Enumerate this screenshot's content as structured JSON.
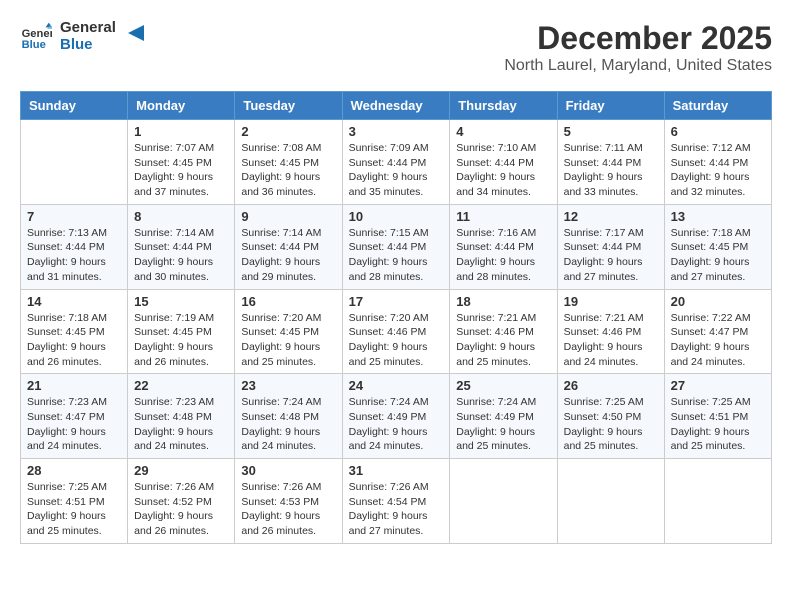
{
  "header": {
    "logo_line1": "General",
    "logo_line2": "Blue",
    "month_title": "December 2025",
    "location": "North Laurel, Maryland, United States"
  },
  "days_of_week": [
    "Sunday",
    "Monday",
    "Tuesday",
    "Wednesday",
    "Thursday",
    "Friday",
    "Saturday"
  ],
  "weeks": [
    [
      {
        "day": "",
        "sunrise": "",
        "sunset": "",
        "daylight": ""
      },
      {
        "day": "1",
        "sunrise": "Sunrise: 7:07 AM",
        "sunset": "Sunset: 4:45 PM",
        "daylight": "Daylight: 9 hours and 37 minutes."
      },
      {
        "day": "2",
        "sunrise": "Sunrise: 7:08 AM",
        "sunset": "Sunset: 4:45 PM",
        "daylight": "Daylight: 9 hours and 36 minutes."
      },
      {
        "day": "3",
        "sunrise": "Sunrise: 7:09 AM",
        "sunset": "Sunset: 4:44 PM",
        "daylight": "Daylight: 9 hours and 35 minutes."
      },
      {
        "day": "4",
        "sunrise": "Sunrise: 7:10 AM",
        "sunset": "Sunset: 4:44 PM",
        "daylight": "Daylight: 9 hours and 34 minutes."
      },
      {
        "day": "5",
        "sunrise": "Sunrise: 7:11 AM",
        "sunset": "Sunset: 4:44 PM",
        "daylight": "Daylight: 9 hours and 33 minutes."
      },
      {
        "day": "6",
        "sunrise": "Sunrise: 7:12 AM",
        "sunset": "Sunset: 4:44 PM",
        "daylight": "Daylight: 9 hours and 32 minutes."
      }
    ],
    [
      {
        "day": "7",
        "sunrise": "Sunrise: 7:13 AM",
        "sunset": "Sunset: 4:44 PM",
        "daylight": "Daylight: 9 hours and 31 minutes."
      },
      {
        "day": "8",
        "sunrise": "Sunrise: 7:14 AM",
        "sunset": "Sunset: 4:44 PM",
        "daylight": "Daylight: 9 hours and 30 minutes."
      },
      {
        "day": "9",
        "sunrise": "Sunrise: 7:14 AM",
        "sunset": "Sunset: 4:44 PM",
        "daylight": "Daylight: 9 hours and 29 minutes."
      },
      {
        "day": "10",
        "sunrise": "Sunrise: 7:15 AM",
        "sunset": "Sunset: 4:44 PM",
        "daylight": "Daylight: 9 hours and 28 minutes."
      },
      {
        "day": "11",
        "sunrise": "Sunrise: 7:16 AM",
        "sunset": "Sunset: 4:44 PM",
        "daylight": "Daylight: 9 hours and 28 minutes."
      },
      {
        "day": "12",
        "sunrise": "Sunrise: 7:17 AM",
        "sunset": "Sunset: 4:44 PM",
        "daylight": "Daylight: 9 hours and 27 minutes."
      },
      {
        "day": "13",
        "sunrise": "Sunrise: 7:18 AM",
        "sunset": "Sunset: 4:45 PM",
        "daylight": "Daylight: 9 hours and 27 minutes."
      }
    ],
    [
      {
        "day": "14",
        "sunrise": "Sunrise: 7:18 AM",
        "sunset": "Sunset: 4:45 PM",
        "daylight": "Daylight: 9 hours and 26 minutes."
      },
      {
        "day": "15",
        "sunrise": "Sunrise: 7:19 AM",
        "sunset": "Sunset: 4:45 PM",
        "daylight": "Daylight: 9 hours and 26 minutes."
      },
      {
        "day": "16",
        "sunrise": "Sunrise: 7:20 AM",
        "sunset": "Sunset: 4:45 PM",
        "daylight": "Daylight: 9 hours and 25 minutes."
      },
      {
        "day": "17",
        "sunrise": "Sunrise: 7:20 AM",
        "sunset": "Sunset: 4:46 PM",
        "daylight": "Daylight: 9 hours and 25 minutes."
      },
      {
        "day": "18",
        "sunrise": "Sunrise: 7:21 AM",
        "sunset": "Sunset: 4:46 PM",
        "daylight": "Daylight: 9 hours and 25 minutes."
      },
      {
        "day": "19",
        "sunrise": "Sunrise: 7:21 AM",
        "sunset": "Sunset: 4:46 PM",
        "daylight": "Daylight: 9 hours and 24 minutes."
      },
      {
        "day": "20",
        "sunrise": "Sunrise: 7:22 AM",
        "sunset": "Sunset: 4:47 PM",
        "daylight": "Daylight: 9 hours and 24 minutes."
      }
    ],
    [
      {
        "day": "21",
        "sunrise": "Sunrise: 7:23 AM",
        "sunset": "Sunset: 4:47 PM",
        "daylight": "Daylight: 9 hours and 24 minutes."
      },
      {
        "day": "22",
        "sunrise": "Sunrise: 7:23 AM",
        "sunset": "Sunset: 4:48 PM",
        "daylight": "Daylight: 9 hours and 24 minutes."
      },
      {
        "day": "23",
        "sunrise": "Sunrise: 7:24 AM",
        "sunset": "Sunset: 4:48 PM",
        "daylight": "Daylight: 9 hours and 24 minutes."
      },
      {
        "day": "24",
        "sunrise": "Sunrise: 7:24 AM",
        "sunset": "Sunset: 4:49 PM",
        "daylight": "Daylight: 9 hours and 24 minutes."
      },
      {
        "day": "25",
        "sunrise": "Sunrise: 7:24 AM",
        "sunset": "Sunset: 4:49 PM",
        "daylight": "Daylight: 9 hours and 25 minutes."
      },
      {
        "day": "26",
        "sunrise": "Sunrise: 7:25 AM",
        "sunset": "Sunset: 4:50 PM",
        "daylight": "Daylight: 9 hours and 25 minutes."
      },
      {
        "day": "27",
        "sunrise": "Sunrise: 7:25 AM",
        "sunset": "Sunset: 4:51 PM",
        "daylight": "Daylight: 9 hours and 25 minutes."
      }
    ],
    [
      {
        "day": "28",
        "sunrise": "Sunrise: 7:25 AM",
        "sunset": "Sunset: 4:51 PM",
        "daylight": "Daylight: 9 hours and 25 minutes."
      },
      {
        "day": "29",
        "sunrise": "Sunrise: 7:26 AM",
        "sunset": "Sunset: 4:52 PM",
        "daylight": "Daylight: 9 hours and 26 minutes."
      },
      {
        "day": "30",
        "sunrise": "Sunrise: 7:26 AM",
        "sunset": "Sunset: 4:53 PM",
        "daylight": "Daylight: 9 hours and 26 minutes."
      },
      {
        "day": "31",
        "sunrise": "Sunrise: 7:26 AM",
        "sunset": "Sunset: 4:54 PM",
        "daylight": "Daylight: 9 hours and 27 minutes."
      },
      {
        "day": "",
        "sunrise": "",
        "sunset": "",
        "daylight": ""
      },
      {
        "day": "",
        "sunrise": "",
        "sunset": "",
        "daylight": ""
      },
      {
        "day": "",
        "sunrise": "",
        "sunset": "",
        "daylight": ""
      }
    ]
  ]
}
